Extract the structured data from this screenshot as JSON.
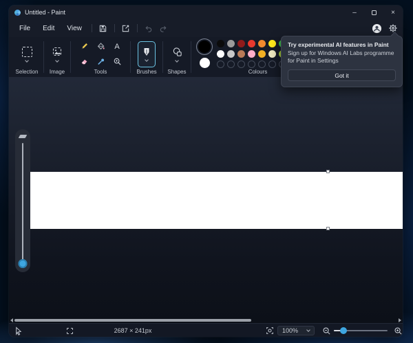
{
  "window": {
    "title": "Untitled - Paint",
    "controls": {
      "minimize": "–",
      "close": "×"
    }
  },
  "menubar": {
    "items": [
      "File",
      "Edit",
      "View"
    ]
  },
  "ribbon": {
    "sections": [
      "Selection",
      "Image",
      "Tools",
      "Brushes",
      "Shapes",
      "Colours"
    ],
    "colour1": "#000000",
    "colour2": "#ffffff",
    "palette": {
      "rows": [
        [
          "#0b0b0b",
          "#9b9b9b",
          "#8e1b1b",
          "#e8392e",
          "#f28a2e",
          "#ffe81c",
          "#3cb54a",
          "#28a0e0",
          "#5a60c8",
          "#a349a4"
        ],
        [
          "#ffffff",
          "#c8c8c8",
          "#b97a57",
          "#ffaec9",
          "#f2b124",
          "#efe9c0",
          "#a7cc3a",
          "#5bb8e8",
          "#7a96c8",
          "#c8bfe7"
        ],
        [
          null,
          null,
          null,
          null,
          null,
          null,
          null,
          null,
          null,
          null
        ]
      ]
    }
  },
  "flyout": {
    "title": "Try experimental AI features in Paint",
    "body": "Sign up for Windows AI Labs programme for Paint in Settings",
    "button": "Got it"
  },
  "statusbar": {
    "image_size": "2687 × 241px",
    "zoom_level": "100%"
  },
  "colors": {
    "accent": "#3ea6e0",
    "canvas": "#ffffff"
  }
}
